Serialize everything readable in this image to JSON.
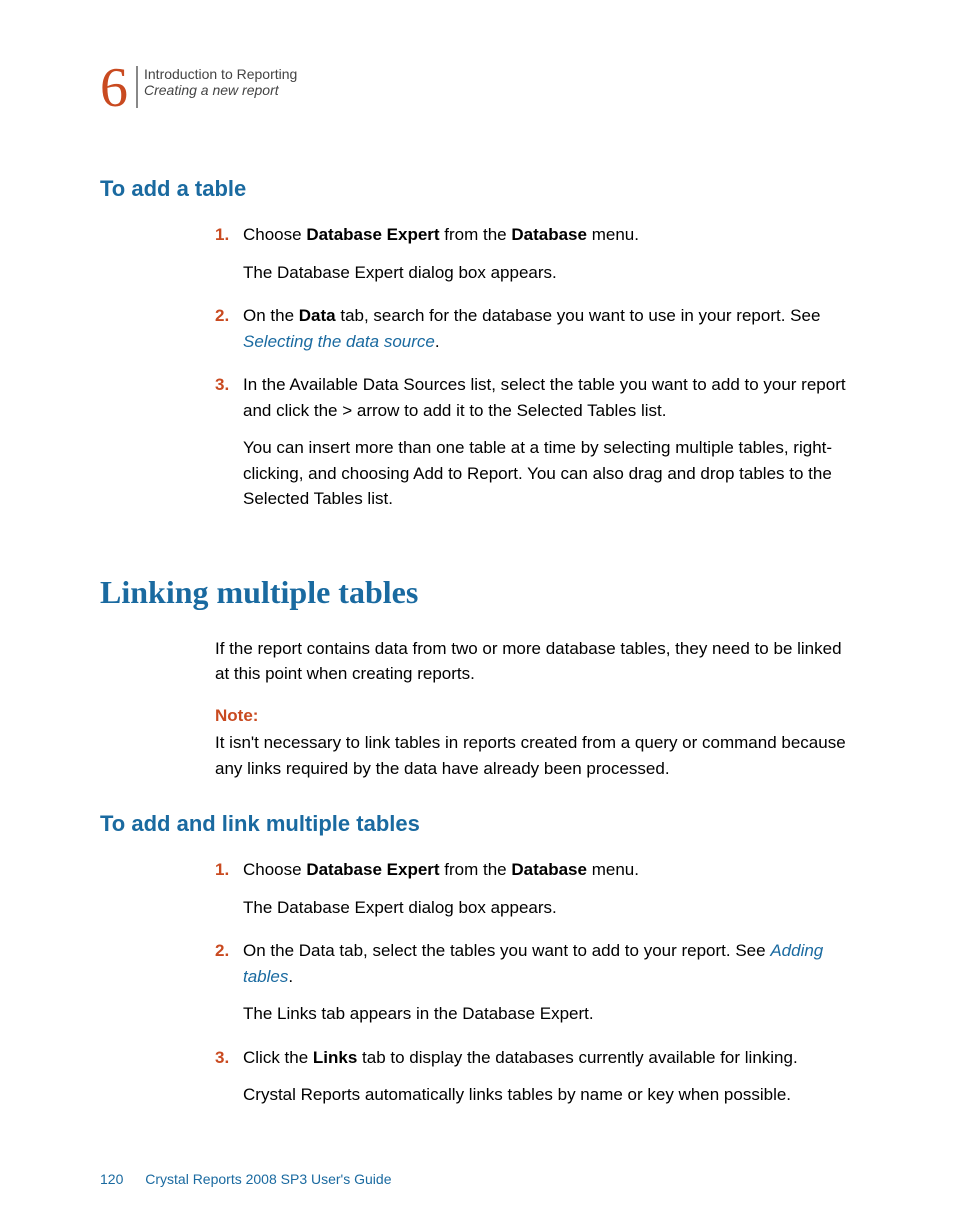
{
  "header": {
    "chapter_number": "6",
    "line1": "Introduction to Reporting",
    "line2": "Creating a new report"
  },
  "section1": {
    "title": "To add a table",
    "step1": {
      "num": "1.",
      "t1": "Choose ",
      "b1": "Database Expert",
      "t2": " from the ",
      "b2": "Database",
      "t3": " menu.",
      "p2": "The Database Expert dialog box appears."
    },
    "step2": {
      "num": "2.",
      "t1": "On the ",
      "b1": "Data",
      "t2": " tab, search for the database you want to use in your report. See ",
      "link": "Selecting the data source",
      "t3": "."
    },
    "step3": {
      "num": "3.",
      "p1": "In the Available Data Sources list, select the table you want to add to your report and click the > arrow to add it to the Selected Tables list.",
      "p2": "You can insert more than one table at a time by selecting multiple tables, right-clicking, and choosing Add to Report. You can also drag and drop tables to the Selected Tables list."
    }
  },
  "section2": {
    "title": "Linking multiple tables",
    "intro": "If the report contains data from two or more database tables, they need to be linked at this point when creating reports.",
    "note_label": "Note:",
    "note_text": "It isn't necessary to link tables in reports created from a query or command because any links required by the data have already been processed."
  },
  "section3": {
    "title": "To add and link multiple tables",
    "step1": {
      "num": "1.",
      "t1": "Choose ",
      "b1": "Database Expert",
      "t2": " from the ",
      "b2": "Database",
      "t3": " menu.",
      "p2": "The Database Expert dialog box appears."
    },
    "step2": {
      "num": "2.",
      "t1": "On the Data tab, select the tables you want to add to your report. See ",
      "link": "Adding tables",
      "t2": ".",
      "p2": "The Links tab appears in the Database Expert."
    },
    "step3": {
      "num": "3.",
      "t1": "Click the ",
      "b1": "Links",
      "t2": " tab to display the databases currently available for linking.",
      "p2": "Crystal Reports automatically links tables by name or key when possible."
    }
  },
  "footer": {
    "page": "120",
    "title": "Crystal Reports 2008 SP3 User's Guide"
  }
}
